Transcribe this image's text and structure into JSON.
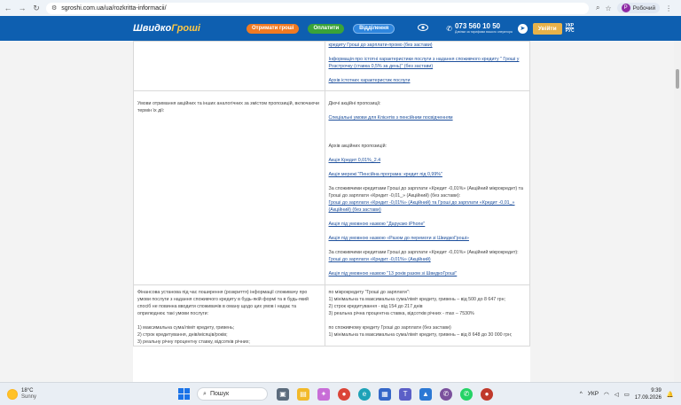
{
  "browser": {
    "url": "sgroshi.com.ua/ua/rozkritta-informacii/",
    "profile_name": "Робочий",
    "profile_initial": "Р",
    "nav": {
      "back": "←",
      "forward": "→",
      "reload": "↻"
    }
  },
  "header": {
    "logo_part1": "Швидко",
    "logo_part2": "Гроші",
    "btn_get_money": "Отримати гроші",
    "btn_pay": "Оплатити",
    "btn_branches": "Відділення",
    "phone_number": "073 560 10 50",
    "phone_sub": "Дзвінки за тарифами вашого оператора",
    "login": "Увійти",
    "lang_ukr": "УКР",
    "lang_rus": "РУС",
    "colors": {
      "brand": "#0e5fb0",
      "orange": "#f07a22",
      "green": "#3aa339",
      "gold": "#e7b24a"
    }
  },
  "table": {
    "row1_right": [
      {
        "type": "link",
        "text": "кредиту Гроші до зарплати-промо (без застави)"
      },
      {
        "type": "gap"
      },
      {
        "type": "link",
        "text": "Інформація про істотні характеристики послуги з надання споживчого кредиту \" Гроші у Розстрочку (ставка 0,5% за день)\" (без застави)"
      },
      {
        "type": "gap"
      },
      {
        "type": "link",
        "text": "Архів істотних характеристик послуги"
      }
    ],
    "row2_left": "Умови отримання акційних та інших аналогічних за змістом пропозицій, включаючи термін їх дії:",
    "row2_right": [
      {
        "type": "text",
        "text": "Діючі акційні пропозиції:"
      },
      {
        "type": "gap"
      },
      {
        "type": "link",
        "text": "Спеціальні умови для Клієнтів з пенсійним посвідченням"
      },
      {
        "type": "gapbig"
      },
      {
        "type": "text",
        "text": "Архів акційних пропозицій:"
      },
      {
        "type": "gap"
      },
      {
        "type": "link",
        "text": "Акція Кредит 0,01%_2.4"
      },
      {
        "type": "gap"
      },
      {
        "type": "link",
        "text": "Акція мережі \"Пенсійна програма: кредит під 0,99%\""
      },
      {
        "type": "gap"
      },
      {
        "type": "text",
        "text": "За споживчими кредитами Гроші до зарплати «Кредит -0,01%» (Акційний мікрокредит) та Гроші до зарплати «Кредит -0,01_» (Акційний) (без застави):"
      },
      {
        "type": "link",
        "text": "Гроші до зарплати «Кредит -0,01%» (Акційний) та Гроші до зарплати «Кредит -0,01_» (Акційний) (без застави)"
      },
      {
        "type": "gap"
      },
      {
        "type": "link",
        "text": "Акція під умовною назвою \"Даруємо iPhone\""
      },
      {
        "type": "gap"
      },
      {
        "type": "link",
        "text": "Акція під умовною назвою «Разом до перемоги зі ШвидкоГроші»"
      },
      {
        "type": "gap"
      },
      {
        "type": "text",
        "text": "За споживчими кредитами Гроші до зарплати «Кредит -0,01%» (Акційний мікрокредит):"
      },
      {
        "type": "link",
        "text": "Гроші до зарплати «Кредит -0,01%» (Акційний)"
      },
      {
        "type": "gap"
      },
      {
        "type": "link",
        "text": "Акція під умовною назвою \"13 років разом зі ШвидкоГроші\""
      }
    ],
    "row3_left": [
      {
        "type": "text",
        "text": "Фінансова установа під час поширення (розкриття) інформації споживачу про умови послуги з надання споживчого кредиту в будь-якій формі та в будь-який спосіб не повинна вводити споживачів в оману щодо цих умов і надає та оприлюднює такі умови послуги:"
      },
      {
        "type": "gap"
      },
      {
        "type": "text",
        "text": "1) максимальна сума/ліміт кредиту, гривень;"
      },
      {
        "type": "text",
        "text": "2) строк кредитування, днів/місяців/років;"
      },
      {
        "type": "text",
        "text": "3) реальну річну процентну ставку, відсотків річних;"
      }
    ],
    "row3_right": [
      {
        "type": "text",
        "text": "по мікрокредиту \"Гроші до зарплати\":"
      },
      {
        "type": "text",
        "text": "1) мінімальна та максимальна сума/ліміт кредиту, гривень – від 500 до 8 647 грн;"
      },
      {
        "type": "text",
        "text": "2) строк кредитування - від 154 до 217 днів"
      },
      {
        "type": "text",
        "text": "3) реальна річна процентна ставка, відсотків річних - max – 7530%"
      },
      {
        "type": "gap"
      },
      {
        "type": "text",
        "text": "по споживчому кредиту Гроші до зарплати (без застави)"
      },
      {
        "type": "text",
        "text": "1) мінімальна та максимальна сума/ліміт кредиту, гривень – від 8 648 до 30 000 грн;"
      }
    ]
  },
  "taskbar": {
    "temp": "18°C",
    "condition": "Sunny",
    "search": "Пошук",
    "lang": "УКР",
    "time": "9:39",
    "date": "17.09.2026"
  }
}
